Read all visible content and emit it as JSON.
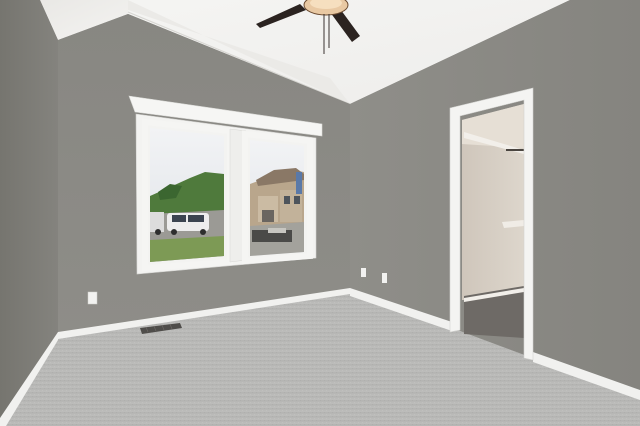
{
  "scene": {
    "description_kind": "photo",
    "room": "empty bedroom",
    "features": [
      "vaulted-ceiling",
      "ceiling-fan",
      "double-window",
      "walk-in-closet-doorway",
      "carpet-floor",
      "baseboards",
      "electrical-outlets",
      "floor-vent"
    ],
    "colors": {
      "ceiling": "#f1f0ee",
      "wall_left": "#7f7e7a",
      "wall_back": "#8d8c87",
      "wall_right": "#8b8a85",
      "trim": "#f4f4f2",
      "carpet": "#b9b9b7",
      "closet_wall": "#d9d2c8",
      "fan_blade": "#2b2320"
    }
  }
}
